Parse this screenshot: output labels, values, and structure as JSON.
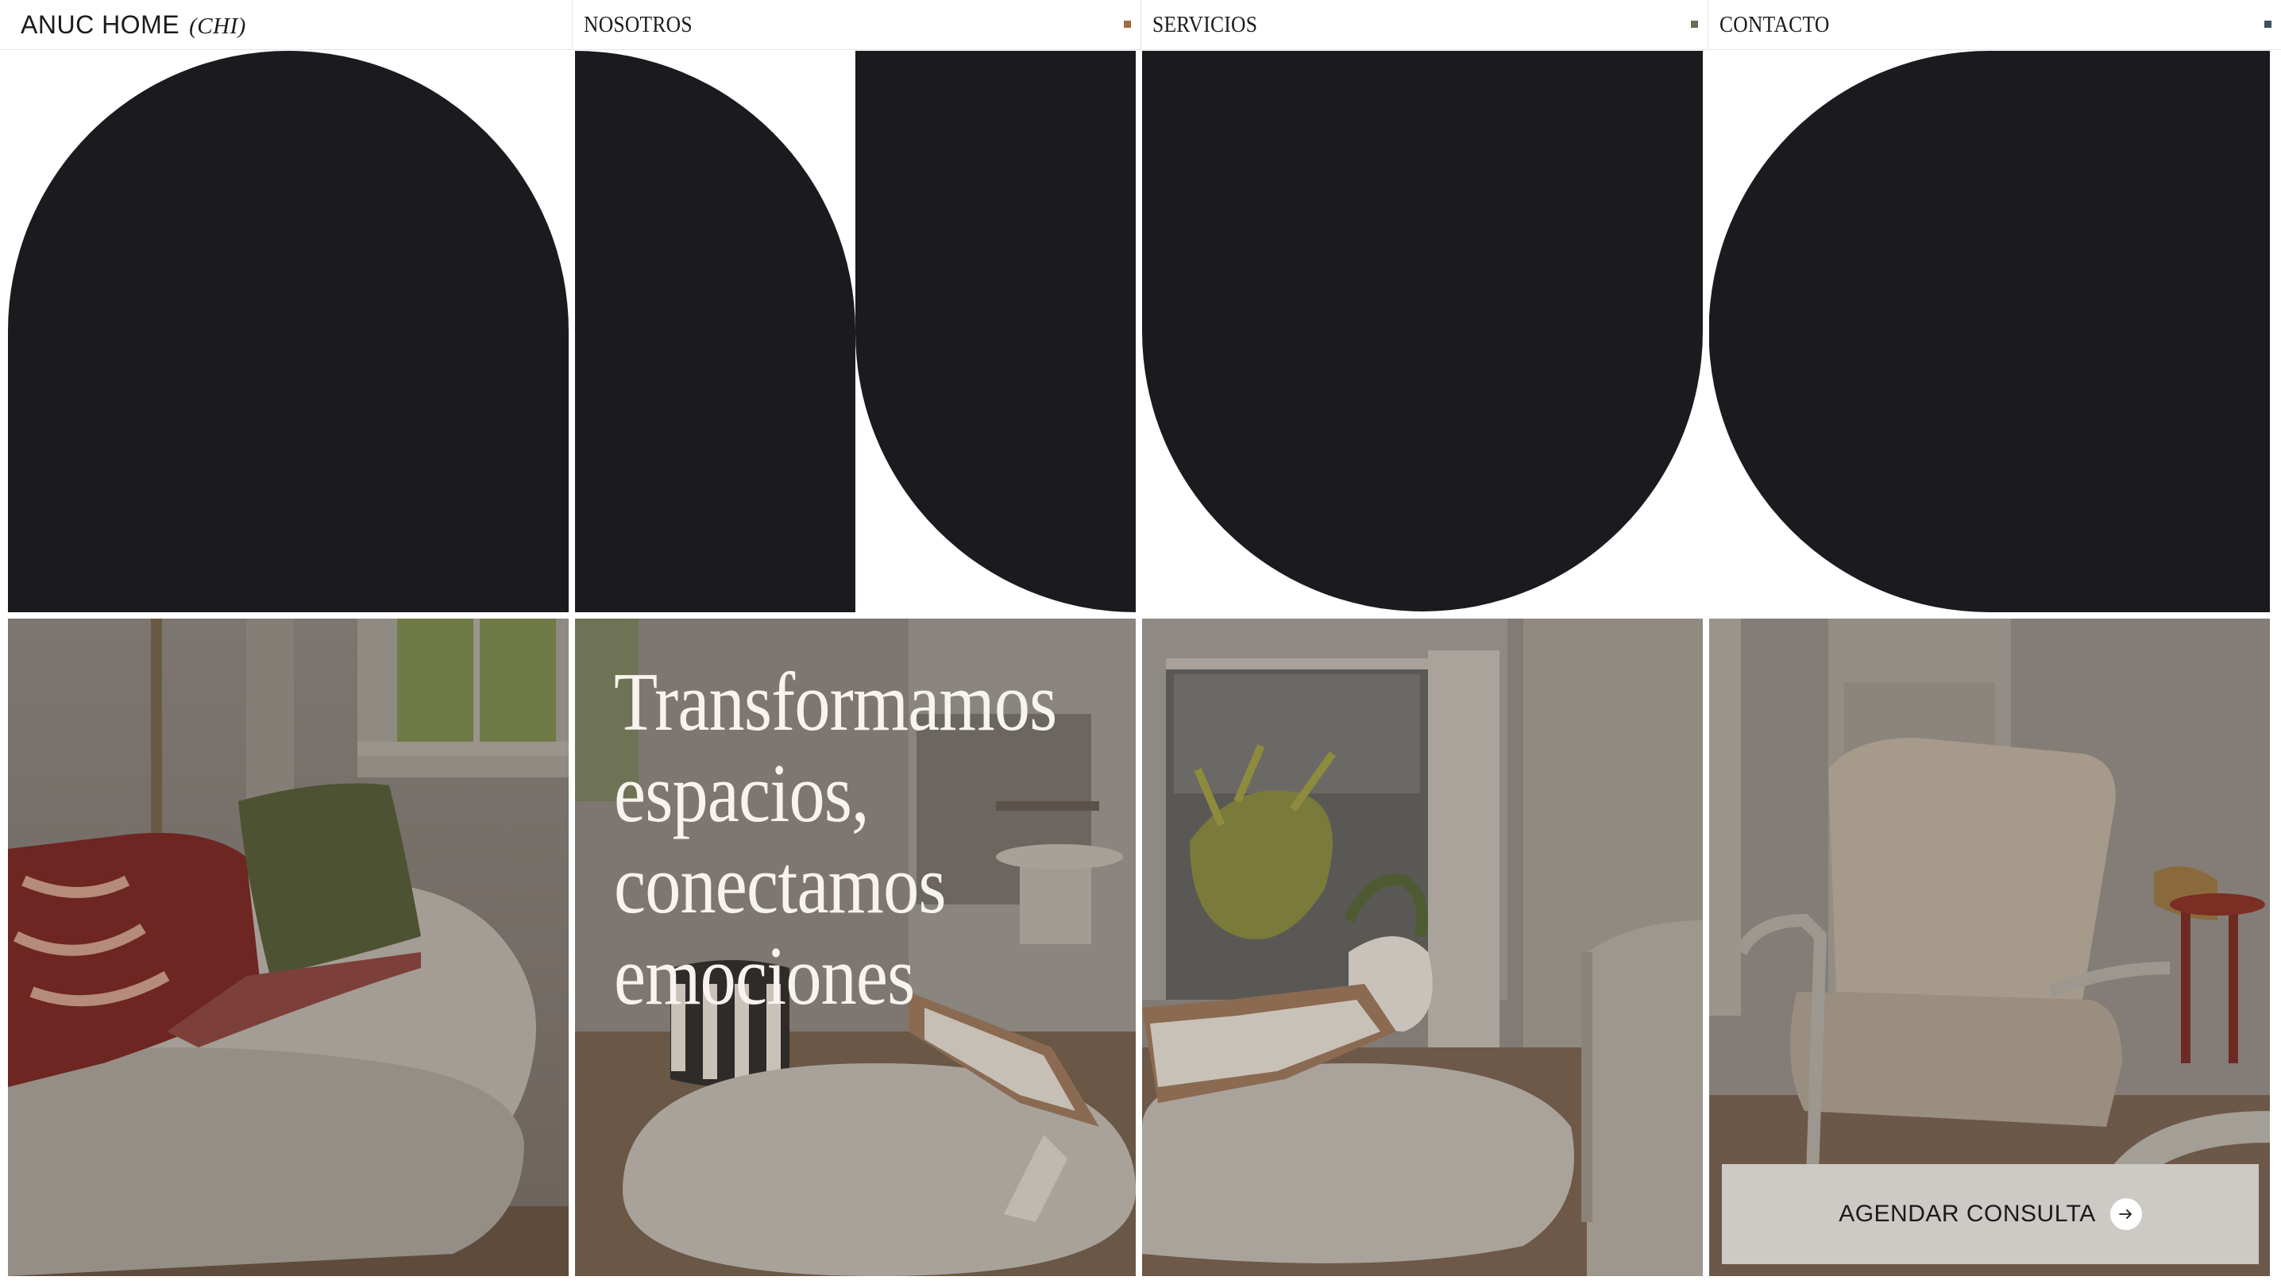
{
  "brand": {
    "name": "ANUC HOME",
    "tag": "(CHI)"
  },
  "nav": {
    "items": [
      {
        "label": "NOSOTROS",
        "dot_color": "#a4693e"
      },
      {
        "label": "SERVICIOS",
        "dot_color": "#6f6a52"
      },
      {
        "label": "CONTACTO",
        "dot_color": "#40505e"
      }
    ]
  },
  "hero": {
    "headline_lines": [
      "Transformamos",
      "espacios,",
      "conectamos",
      "emociones"
    ]
  },
  "cta": {
    "label": "AGENDAR CONSULTA",
    "icon": "arrow-right-icon"
  },
  "colors": {
    "shape": "#1b1a1f",
    "headline_text": "#f7f3ee",
    "cta_background": "#cdc9c4",
    "background": "#ffffff"
  }
}
